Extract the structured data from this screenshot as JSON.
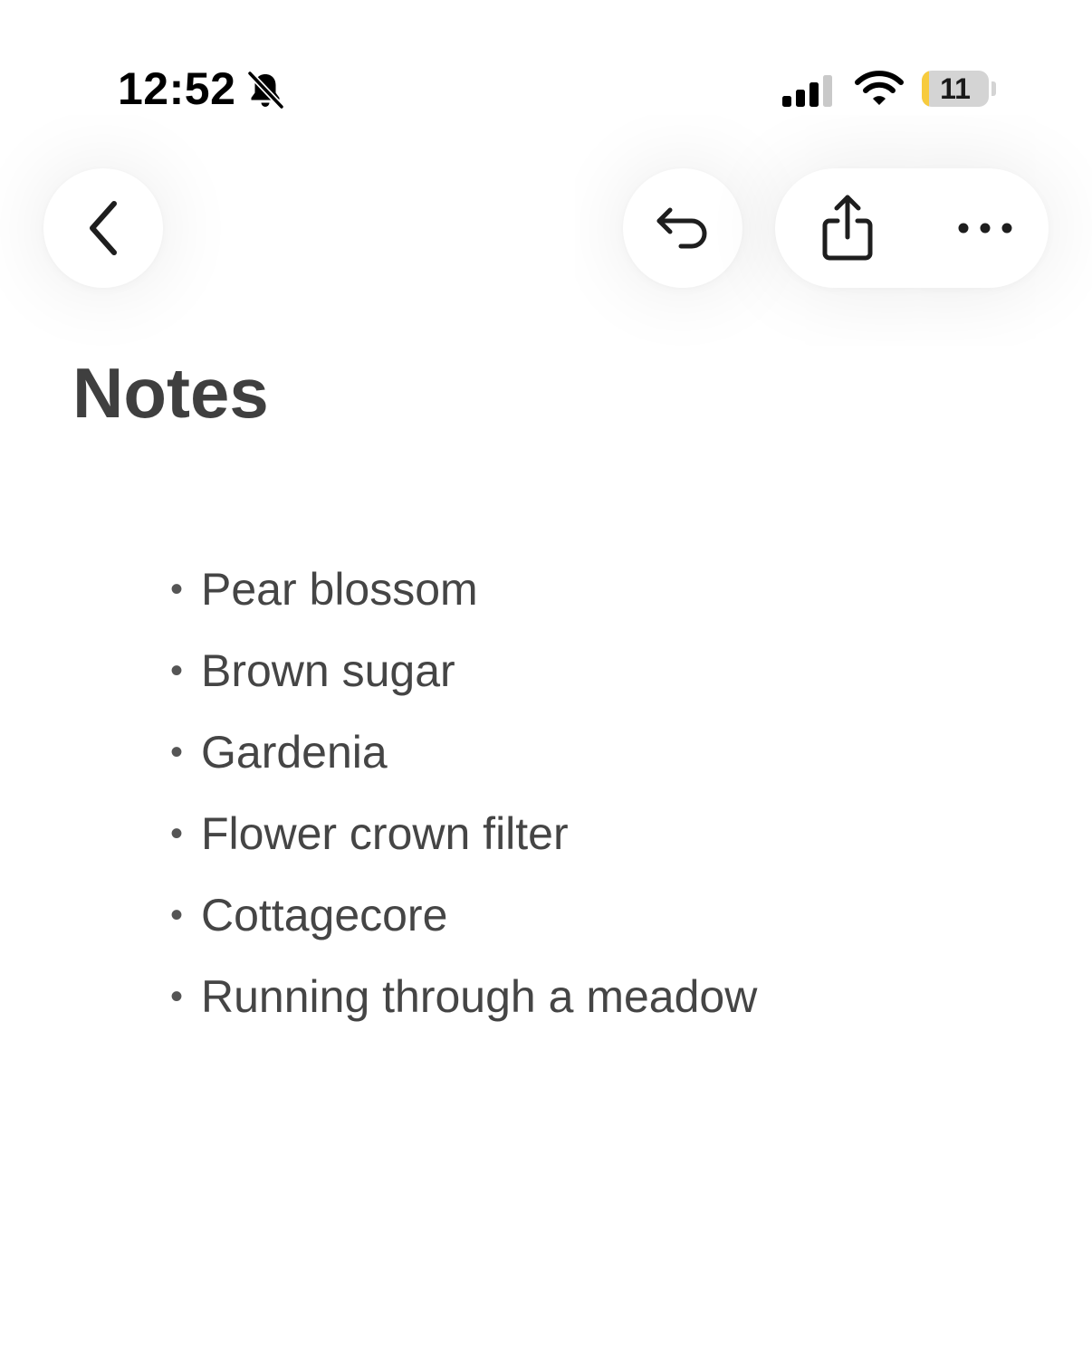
{
  "status_bar": {
    "time": "12:52",
    "silent_icon": "bell-slash-icon",
    "signal_icon": "cellular-signal-icon",
    "wifi_icon": "wifi-icon",
    "battery_level": "11",
    "battery_fill_fraction": 0.11,
    "battery_fill_color": "#f7cb3d"
  },
  "nav": {
    "back_icon": "chevron-left-icon",
    "undo_icon": "undo-arrow-icon",
    "share_icon": "share-icon",
    "more_icon": "ellipsis-icon"
  },
  "note": {
    "title": "Notes",
    "bullet_char": "•",
    "items": [
      "Pear blossom",
      "Brown sugar",
      "Gardenia",
      "Flower crown filter",
      "Cottagecore",
      "Running through a meadow"
    ]
  }
}
